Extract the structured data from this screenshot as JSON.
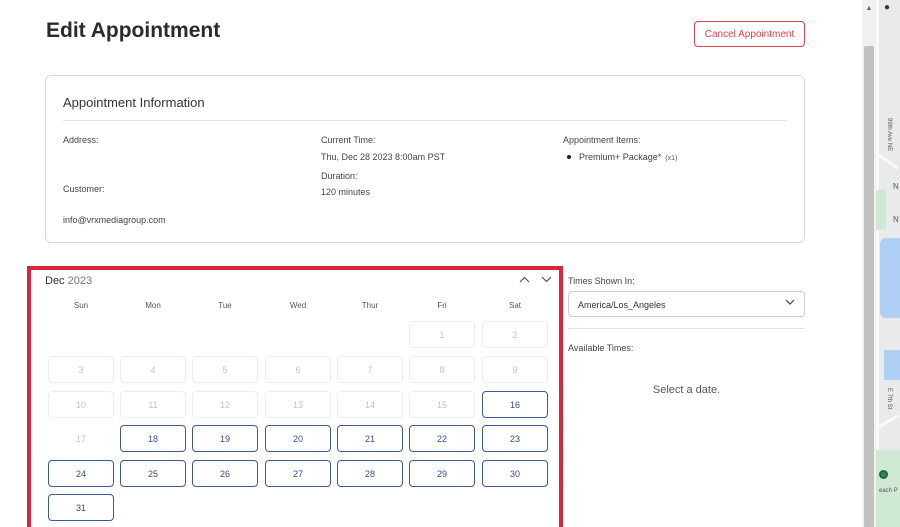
{
  "page": {
    "title": "Edit Appointment",
    "cancel_label": "Cancel Appointment"
  },
  "info": {
    "title": "Appointment Information",
    "address_label": "Address:",
    "customer_label": "Customer:",
    "customer_email": "info@vrxmediagroup.com",
    "current_time_label": "Current Time:",
    "current_time_value": "Thu, Dec 28 2023 8:00am PST",
    "duration_label": "Duration:",
    "duration_value": "120 minutes",
    "items_label": "Appointment Items:",
    "item_name": "Premium+ Package*",
    "item_qty": "(x1)"
  },
  "calendar": {
    "month": "Dec",
    "year": "2023",
    "weekdays": [
      "Sun",
      "Mon",
      "Tue",
      "Wed",
      "Thur",
      "Fri",
      "Sat"
    ],
    "weeks": [
      [
        null,
        null,
        null,
        null,
        null,
        {
          "d": "1",
          "s": "disabled"
        },
        {
          "d": "2",
          "s": "disabled"
        }
      ],
      [
        {
          "d": "3",
          "s": "disabled"
        },
        {
          "d": "4",
          "s": "disabled"
        },
        {
          "d": "5",
          "s": "disabled"
        },
        {
          "d": "6",
          "s": "disabled"
        },
        {
          "d": "7",
          "s": "disabled"
        },
        {
          "d": "8",
          "s": "disabled"
        },
        {
          "d": "9",
          "s": "disabled"
        }
      ],
      [
        {
          "d": "10",
          "s": "disabled"
        },
        {
          "d": "11",
          "s": "disabled"
        },
        {
          "d": "12",
          "s": "disabled"
        },
        {
          "d": "13",
          "s": "disabled"
        },
        {
          "d": "14",
          "s": "disabled"
        },
        {
          "d": "15",
          "s": "disabled"
        },
        {
          "d": "16",
          "s": "available"
        }
      ],
      [
        {
          "d": "17",
          "s": "plain"
        },
        {
          "d": "18",
          "s": "available"
        },
        {
          "d": "19",
          "s": "available"
        },
        {
          "d": "20",
          "s": "available"
        },
        {
          "d": "21",
          "s": "available"
        },
        {
          "d": "22",
          "s": "available"
        },
        {
          "d": "23",
          "s": "available"
        }
      ],
      [
        {
          "d": "24",
          "s": "available"
        },
        {
          "d": "25",
          "s": "available"
        },
        {
          "d": "26",
          "s": "available"
        },
        {
          "d": "27",
          "s": "available"
        },
        {
          "d": "28",
          "s": "available"
        },
        {
          "d": "29",
          "s": "available"
        },
        {
          "d": "30",
          "s": "available"
        }
      ],
      [
        {
          "d": "31",
          "s": "available"
        },
        null,
        null,
        null,
        null,
        null,
        null
      ]
    ],
    "prev_icon": "chevron-up-icon",
    "next_icon": "chevron-down-icon"
  },
  "times": {
    "label": "Times Shown In:",
    "timezone": "America/Los_Angeles",
    "available_label": "Available Times:",
    "empty_message": "Select a date."
  },
  "map": {
    "label_street_1": "99th Ave NE",
    "label_street_2": "E 7th St",
    "label_partial": "each P",
    "label_n1": "N",
    "label_n2": "N"
  },
  "colors": {
    "accent_red": "#d7283a",
    "cancel_red": "#d9434c",
    "available_blue": "#3c5a94"
  }
}
